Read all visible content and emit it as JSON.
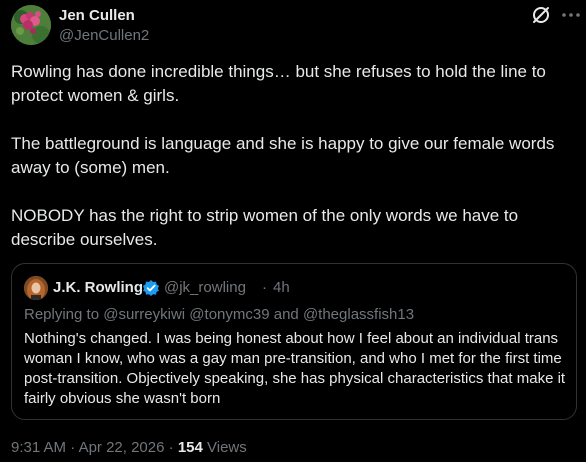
{
  "author": {
    "display_name": "Jen Cullen",
    "handle": "@JenCullen2",
    "avatar_icon": "flower-photo"
  },
  "header_actions": {
    "grok_icon": "grok-icon",
    "more_icon": "more-dots-icon"
  },
  "tweet": {
    "paragraphs": [
      "Rowling has done incredible things… but she refuses to hold the line to protect women & girls.",
      "The battleground is language and she is happy to give our female words away to (some) men.",
      "NOBODY has the right to strip women of the only words we have to describe ourselves."
    ]
  },
  "quote": {
    "display_name": "J.K. Rowling",
    "verified": true,
    "handle": "@jk_rowling",
    "dot": "·",
    "time": "4h",
    "reply_prefix": "Replying to",
    "mention_1": "@surreykiwi",
    "mention_2": "@tonymc39",
    "reply_and": "and",
    "mention_3": "@theglassfish13",
    "text": "Nothing's changed. I was being honest about how I feel about an individual trans woman I know, who was a gay man pre-transition, and who I met for the first time post-transition. Objectively speaking, she has physical characteristics that make it fairly obvious she wasn't born"
  },
  "meta": {
    "time": "9:31 AM",
    "sep_1": "·",
    "date": "Apr 22, 2026",
    "sep_2": "·",
    "views_count": "154",
    "views_label": "Views"
  },
  "colors": {
    "background": "#000000",
    "text_primary": "#e7e9ea",
    "text_secondary": "#71767b",
    "border": "#2f3336",
    "verified": "#1d9bf0"
  }
}
